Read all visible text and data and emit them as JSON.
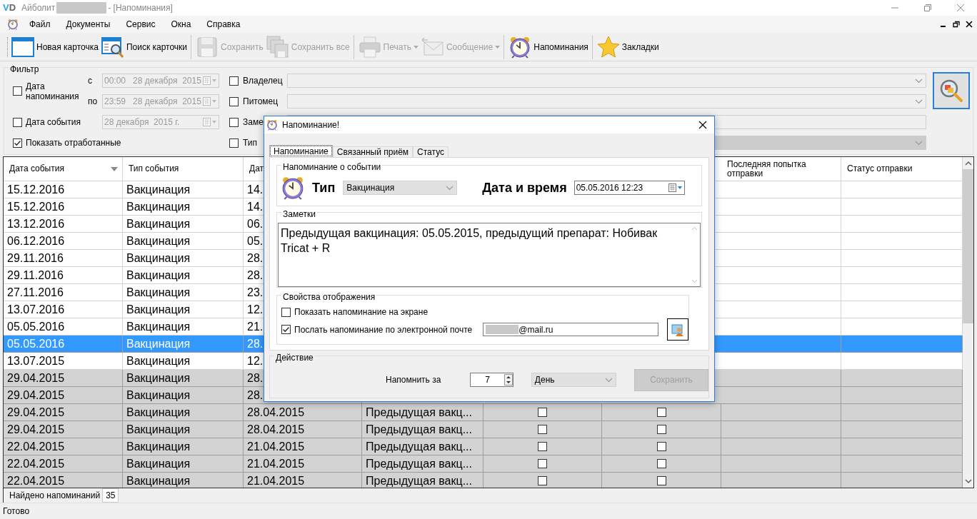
{
  "window": {
    "logo": [
      "V",
      "D"
    ],
    "app": "Айболит",
    "doc": "- [Напоминания]"
  },
  "menu": [
    "Файл",
    "Документы",
    "Сервис",
    "Окна",
    "Справка"
  ],
  "toolbar": [
    {
      "label": "Новая карточка",
      "disabled": false,
      "dropdown": false,
      "separator_after": false
    },
    {
      "label": "Поиск карточки",
      "disabled": false,
      "dropdown": false,
      "separator_after": true
    },
    {
      "label": "Сохранить",
      "disabled": true,
      "dropdown": false,
      "separator_after": false
    },
    {
      "label": "Сохранить все",
      "disabled": true,
      "dropdown": false,
      "separator_after": true
    },
    {
      "label": "Печать",
      "disabled": true,
      "dropdown": true,
      "separator_after": false
    },
    {
      "label": "Сообщение",
      "disabled": true,
      "dropdown": true,
      "separator_after": true
    },
    {
      "label": "Напоминания",
      "disabled": false,
      "dropdown": false,
      "separator_after": true
    },
    {
      "label": "Закладки",
      "disabled": false,
      "dropdown": false,
      "separator_after": false
    }
  ],
  "filter": {
    "title": "Фильтр",
    "reminder_date": {
      "label": "Дата напоминания",
      "checked": false,
      "from_label": "с",
      "from": "00:00   28 декабря  2015",
      "to_label": "по",
      "to": "23:59   28 декабря  2015"
    },
    "event_date": {
      "label": "Дата события",
      "checked": false,
      "value": "28 декабря  2015 г."
    },
    "show_done": {
      "label": "Показать отработанные",
      "checked": true
    },
    "criteria": [
      {
        "label": "Владелец",
        "checked": false,
        "kind": "combo",
        "disabled": false
      },
      {
        "label": "Питомец",
        "checked": false,
        "kind": "combo",
        "disabled": false
      },
      {
        "label": "Заме",
        "checked": false,
        "kind": "text",
        "disabled": false
      },
      {
        "label": "Тип",
        "checked": false,
        "kind": "combo",
        "disabled": true
      }
    ]
  },
  "table": {
    "columns": [
      {
        "label": "Дата события",
        "sorted": true
      },
      {
        "label": "Тип события",
        "sorted": false
      },
      {
        "label": "Дат"
      },
      {
        "label": "Последняя попытка отправки",
        "sorted": false
      },
      {
        "label": "Статус отправки",
        "sorted": false
      }
    ],
    "rows": [
      {
        "column_1": "15.12.2016",
        "column_2": "Вакцинация",
        "column_3": "14.",
        "selected": false,
        "processed": false
      },
      {
        "column_1": "15.12.2016",
        "column_2": "Вакцинация",
        "column_3": "14.",
        "selected": false,
        "processed": false
      },
      {
        "column_1": "13.12.2016",
        "column_2": "Вакцинация",
        "column_3": "06.",
        "selected": false,
        "processed": false
      },
      {
        "column_1": "06.12.2016",
        "column_2": "Вакцинация",
        "column_3": "05.",
        "selected": false,
        "processed": false
      },
      {
        "column_1": "29.11.2016",
        "column_2": "Вакцинация",
        "column_3": "28.",
        "selected": false,
        "processed": false
      },
      {
        "column_1": "29.11.2016",
        "column_2": "Вакцинация",
        "column_3": "28.",
        "selected": false,
        "processed": false
      },
      {
        "column_1": "27.11.2016",
        "column_2": "Вакцинация",
        "column_3": "23.",
        "selected": false,
        "processed": false
      },
      {
        "column_1": "13.07.2016",
        "column_2": "Вакцинация",
        "column_3": "12.",
        "selected": false,
        "processed": false
      },
      {
        "column_1": "05.05.2016",
        "column_2": "Вакцинация",
        "column_3": "21.",
        "selected": false,
        "processed": false
      },
      {
        "column_1": "05.05.2016",
        "column_2": "Вакцинация",
        "column_3": "28.",
        "selected": true,
        "processed": false
      },
      {
        "column_1": "13.07.2015",
        "column_2": "Вакцинация",
        "column_3": "12.",
        "selected": false,
        "processed": false
      },
      {
        "column_1": "29.04.2015",
        "column_2": "Вакцинация",
        "column_3": "28.",
        "selected": false,
        "processed": true
      },
      {
        "column_1": "29.04.2015",
        "column_2": "Вакцинация",
        "column_3": "28.",
        "selected": false,
        "processed": true
      },
      {
        "column_1": "29.04.2015",
        "column_2": "Вакцинация",
        "column_3": "28.04.2015",
        "column_4": "Предыдущая вакц...",
        "column_5_checked": false,
        "column_6_checked": false,
        "selected": false,
        "processed": true
      },
      {
        "column_1": "29.04.2015",
        "column_2": "Вакцинация",
        "column_3": "28.04.2015",
        "column_4": "Предыдущая вакц...",
        "column_5_checked": false,
        "column_6_checked": false,
        "selected": false,
        "processed": true
      },
      {
        "column_1": "22.04.2015",
        "column_2": "Вакцинация",
        "column_3": "21.04.2015",
        "column_4": "Предыдущая вакц...",
        "column_5_checked": false,
        "column_6_checked": false,
        "selected": false,
        "processed": true
      },
      {
        "column_1": "22.04.2015",
        "column_2": "Вакцинация",
        "column_3": "21.04.2015",
        "column_4": "Предыдущая вакц...",
        "column_5_checked": false,
        "column_6_checked": false,
        "selected": false,
        "processed": true
      },
      {
        "column_1": "22.04.2015",
        "column_2": "Вакцинация",
        "column_3": "21.04.2015",
        "column_4": "Предыдущая вакц...",
        "column_5_checked": false,
        "column_6_checked": false,
        "selected": false,
        "processed": true
      }
    ]
  },
  "found": {
    "label": "Найдено напоминаний",
    "count": "35"
  },
  "status": "Готово",
  "dialog": {
    "title": "Напоминание!",
    "tabs": [
      {
        "label": "Напоминание",
        "selected": true
      },
      {
        "label": "Связанный приём",
        "selected": false
      },
      {
        "label": "Статус",
        "selected": false
      }
    ],
    "event": {
      "title": "Напоминание о событии",
      "type_label": "Тип",
      "type_value": "Вакцинация",
      "datetime_label": "Дата и время",
      "datetime_value": "05.05.2016 12:23"
    },
    "notes": {
      "title": "Заметки",
      "text": "Предыдущая вакцинация: 05.05.2015, предыдущий препарат: Нобивак Tricat + R"
    },
    "display": {
      "title": "Свойства отображения",
      "options": [
        {
          "kind": "checkbox",
          "label": "Показать напоминание на экране",
          "checked": false
        },
        {
          "kind": "email",
          "label": "Послать напоминание по электронной почте",
          "checked": true,
          "email": "@mail.ru"
        }
      ]
    },
    "action": {
      "title": "Действие",
      "label": "Напомнить за",
      "count": "7",
      "unit": "День",
      "save": "Сохранить",
      "save_disabled": true
    }
  }
}
